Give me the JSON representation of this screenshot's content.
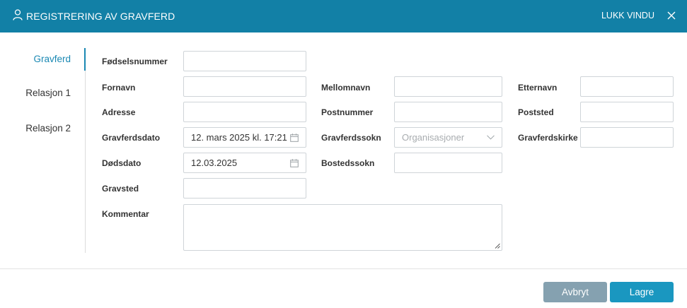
{
  "header": {
    "title": "REGISTRERING AV GRAVFERD",
    "close_label": "LUKK VINDU",
    "colors": {
      "bar": "#1280a6"
    }
  },
  "nav": {
    "items": [
      {
        "label": "Gravferd",
        "active": true
      },
      {
        "label": "Relasjon 1",
        "active": false
      },
      {
        "label": "Relasjon 2",
        "active": false
      }
    ]
  },
  "form": {
    "fodselsnummer": {
      "label": "Fødselsnummer",
      "value": ""
    },
    "fornavn": {
      "label": "Fornavn",
      "value": ""
    },
    "mellomnavn": {
      "label": "Mellomnavn",
      "value": ""
    },
    "etternavn": {
      "label": "Etternavn",
      "value": ""
    },
    "adresse": {
      "label": "Adresse",
      "value": ""
    },
    "postnummer": {
      "label": "Postnummer",
      "value": ""
    },
    "poststed": {
      "label": "Poststed",
      "value": ""
    },
    "gravferdsdato": {
      "label": "Gravferdsdato",
      "value": "12. mars 2025 kl. 17:21"
    },
    "gravferdssokn": {
      "label": "Gravferdssokn",
      "placeholder": "Organisasjoner"
    },
    "gravferdskirke": {
      "label": "Gravferdskirke",
      "value": ""
    },
    "dodsdato": {
      "label": "Dødsdato",
      "value": "12.03.2025"
    },
    "bostedssokn": {
      "label": "Bostedssokn",
      "value": ""
    },
    "gravsted": {
      "label": "Gravsted",
      "value": ""
    },
    "kommentar": {
      "label": "Kommentar",
      "value": ""
    }
  },
  "footer": {
    "cancel_label": "Avbryt",
    "save_label": "Lagre",
    "colors": {
      "cancel": "#85a1b0",
      "save": "#1a97c0"
    }
  },
  "icons": [
    "user-icon",
    "close-icon",
    "calendar-icon",
    "chevron-down-icon",
    "resize-handle-icon"
  ]
}
